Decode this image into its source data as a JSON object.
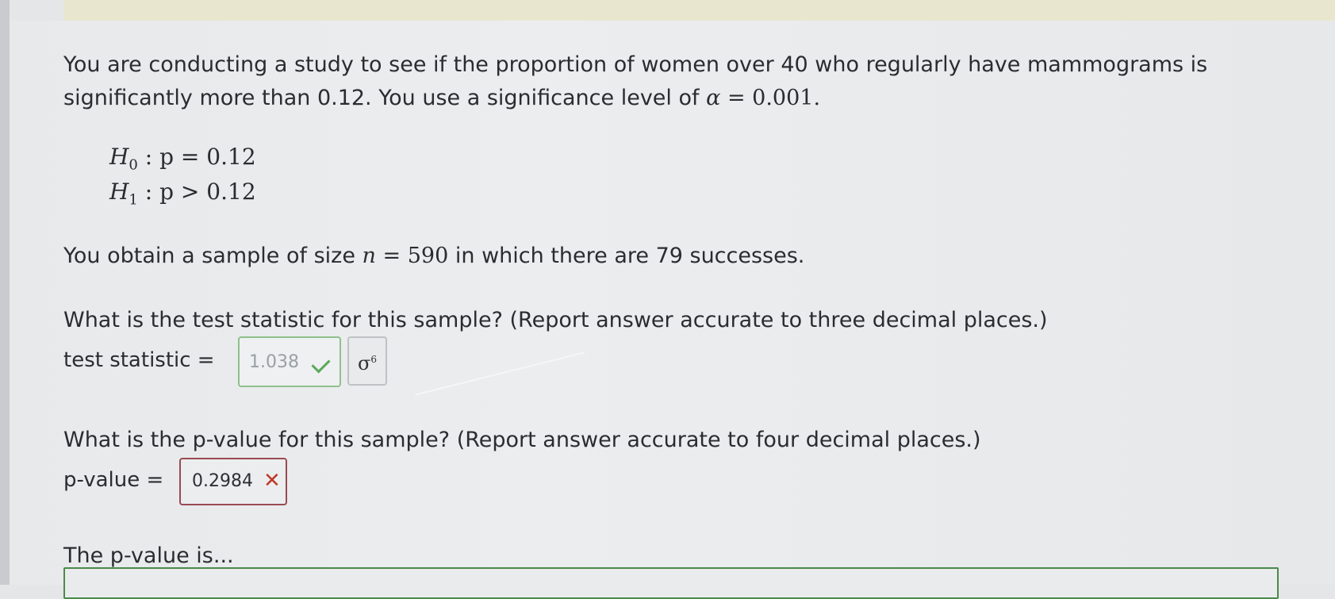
{
  "question": {
    "intro_line1": "You are conducting a study to see if the proportion of women over 40 who regularly have mammograms is",
    "intro_line2_text": "significantly more than 0.12. You use a significance level of",
    "alpha_symbol": "α",
    "alpha_rhs": "= 0.001.",
    "h0": {
      "label": "H",
      "sub": "0",
      "rhs": " : p = 0.12"
    },
    "h1": {
      "label": "H",
      "sub": "1",
      "rhs": " : p > 0.12"
    },
    "sample_pre": "You obtain a sample of size",
    "sample_n": "n",
    "sample_eq": "= 590",
    "sample_post": "in which there are 79 successes."
  },
  "part1": {
    "prompt": "What is the test statistic for this sample? (Report answer accurate to three decimal places.)",
    "label": "test statistic =",
    "value": "1.038",
    "status": "correct",
    "formula_button": "σ",
    "formula_button_sup": "6"
  },
  "part2": {
    "prompt": "What is the p-value for this sample? (Report answer accurate to four decimal places.)",
    "label": "p-value =",
    "value": "0.2984",
    "status": "incorrect",
    "status_mark": "✕"
  },
  "part3": {
    "prompt": "The p-value is...",
    "selected": ""
  },
  "colors": {
    "correct": "#5aa85a",
    "incorrect": "#c0392b",
    "dropdown_border": "#4a8a4a"
  }
}
